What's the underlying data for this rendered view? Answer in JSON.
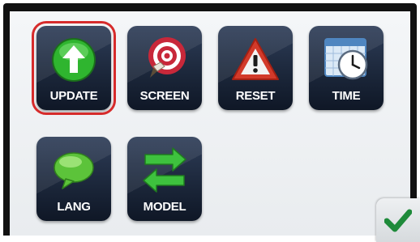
{
  "tiles": {
    "update": {
      "label": "UPDATE",
      "icon": "update-arrow-icon",
      "selected": true
    },
    "screen": {
      "label": "SCREEN",
      "icon": "screen-calibration-icon"
    },
    "reset": {
      "label": "RESET",
      "icon": "warning-triangle-icon"
    },
    "time": {
      "label": "TIME",
      "icon": "clock-calendar-icon"
    },
    "lang": {
      "label": "LANG",
      "icon": "speech-bubble-icon"
    },
    "model": {
      "label": "MODEL",
      "icon": "swap-arrows-icon"
    }
  },
  "confirm": {
    "icon": "checkmark-icon"
  },
  "colors": {
    "tile": "#1f2b40",
    "selection": "#d62b2b",
    "update_green": "#2fb52f",
    "check_green": "#1e8a3a",
    "warning_red": "#d23a2a"
  }
}
